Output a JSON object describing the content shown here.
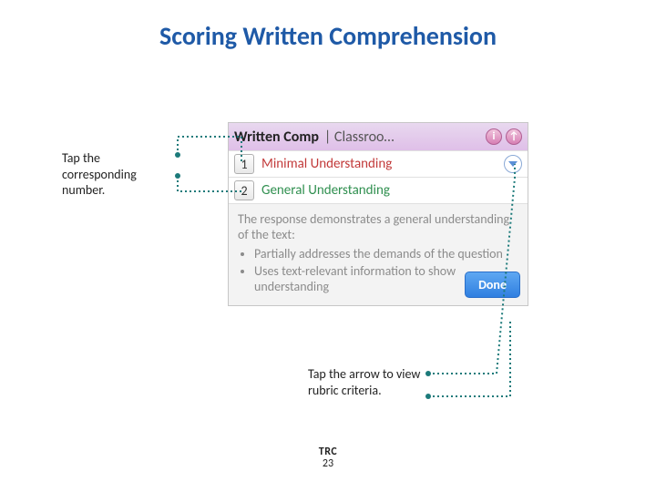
{
  "title": "Scoring Written Comprehension",
  "callout_left": "Tap the corresponding number.",
  "callout_bottom": "Tap the arrow to view rubric criteria.",
  "footer_label": "TRC",
  "footer_page": "23",
  "app": {
    "header_bold": "Written Comp",
    "header_rest": "| Classroo…",
    "icon_info": "i",
    "icon_up": "↑",
    "options": [
      {
        "num": "1",
        "label": "Minimal Understanding",
        "cls": "opt-minimal"
      },
      {
        "num": "2",
        "label": "General Understanding",
        "cls": "opt-general"
      }
    ],
    "criteria_intro": "The response demonstrates a general understanding of the text:",
    "criteria_items": [
      "Partially addresses the demands of the question",
      "Uses text-relevant information to show understanding"
    ],
    "done": "Done"
  }
}
